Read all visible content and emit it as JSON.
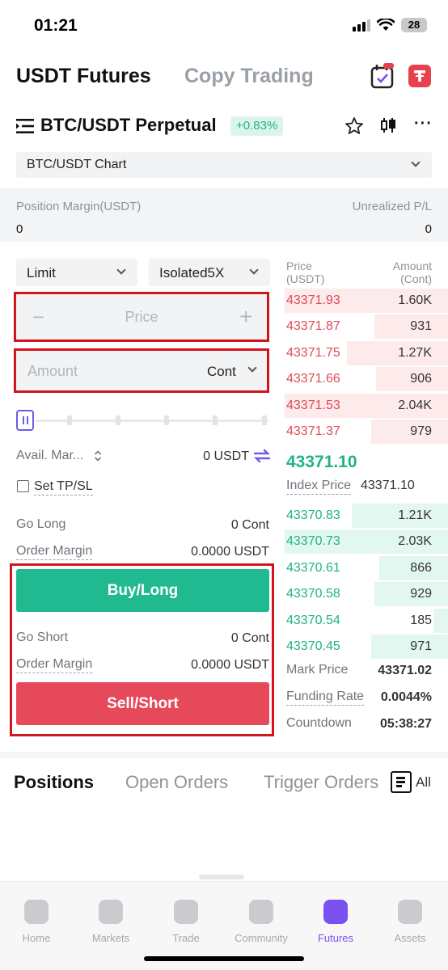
{
  "status": {
    "time": "01:21",
    "battery": "28"
  },
  "header": {
    "title": "USDT Futures",
    "copy_trading": "Copy Trading"
  },
  "pair": {
    "name": "BTC/USDT Perpetual",
    "change": "+0.83%"
  },
  "chart_select": {
    "label": "BTC/USDT Chart"
  },
  "margin": {
    "position_margin_label": "Position Margin(USDT)",
    "position_margin_value": "0",
    "unrealized_label": "Unrealized P/L",
    "unrealized_value": "0"
  },
  "form": {
    "order_type": "Limit",
    "leverage": "Isolated5X",
    "price_placeholder": "Price",
    "minus": "−",
    "plus": "+",
    "amount_placeholder": "Amount",
    "amount_unit": "Cont",
    "avail_label": "Avail. Mar...",
    "avail_value": "0 USDT",
    "tpsl_label": "Set TP/SL",
    "go_long_label": "Go Long",
    "go_long_value": "0 Cont",
    "order_margin_label": "Order Margin",
    "order_margin_long": "0.0000 USDT",
    "buy_label": "Buy/Long",
    "go_short_label": "Go Short",
    "go_short_value": "0 Cont",
    "order_margin_short": "0.0000 USDT",
    "sell_label": "Sell/Short"
  },
  "orderbook": {
    "price_header_1": "Price",
    "price_header_2": "(USDT)",
    "amount_header_1": "Amount",
    "amount_header_2": "(Cont)",
    "asks": [
      {
        "price": "43371.93",
        "amount": "1.60K",
        "depth": 1.0
      },
      {
        "price": "43371.87",
        "amount": "931",
        "depth": 0.45
      },
      {
        "price": "43371.75",
        "amount": "1.27K",
        "depth": 0.62
      },
      {
        "price": "43371.66",
        "amount": "906",
        "depth": 0.44
      },
      {
        "price": "43371.53",
        "amount": "2.04K",
        "depth": 1.0
      },
      {
        "price": "43371.37",
        "amount": "979",
        "depth": 0.47
      }
    ],
    "last_price": "43371.10",
    "index_label": "Index Price",
    "index_value": "43371.10",
    "bids": [
      {
        "price": "43370.83",
        "amount": "1.21K",
        "depth": 0.59
      },
      {
        "price": "43370.73",
        "amount": "2.03K",
        "depth": 1.0
      },
      {
        "price": "43370.61",
        "amount": "866",
        "depth": 0.42
      },
      {
        "price": "43370.58",
        "amount": "929",
        "depth": 0.45
      },
      {
        "price": "43370.54",
        "amount": "185",
        "depth": 0.09
      },
      {
        "price": "43370.45",
        "amount": "971",
        "depth": 0.47
      }
    ],
    "mark_price_label": "Mark Price",
    "mark_price_value": "43371.02",
    "funding_label": "Funding Rate",
    "funding_value": "0.0044%",
    "countdown_label": "Countdown",
    "countdown_value": "05:38:27"
  },
  "positions_tabs": {
    "positions": "Positions",
    "open_orders": "Open Orders",
    "trigger_orders": "Trigger Orders",
    "all": "All"
  },
  "tabbar": [
    {
      "label": "Home",
      "icon": "home-icon"
    },
    {
      "label": "Markets",
      "icon": "markets-icon"
    },
    {
      "label": "Trade",
      "icon": "trade-icon"
    },
    {
      "label": "Community",
      "icon": "community-icon"
    },
    {
      "label": "Futures",
      "icon": "futures-icon",
      "active": true
    },
    {
      "label": "Assets",
      "icon": "assets-icon"
    }
  ],
  "colors": {
    "accent": "#7b4ff0",
    "buy": "#21b98f",
    "sell": "#e64a5a",
    "highlight": "#d0151d"
  }
}
